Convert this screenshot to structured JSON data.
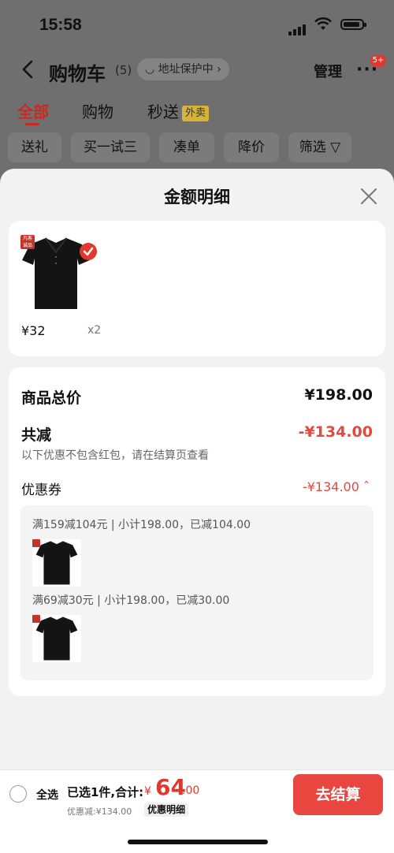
{
  "status": {
    "time": "15:58"
  },
  "nav": {
    "title": "购物车",
    "count": "(5)",
    "address": "地址保护中",
    "manage": "管理",
    "more": "···",
    "badge": "5+"
  },
  "tabs": {
    "all": "全部",
    "shop": "购物",
    "flash": "秒送",
    "waimai": "外卖"
  },
  "chips": [
    "送礼",
    "买一试三",
    "凑单",
    "降价",
    "筛选"
  ],
  "sheet": {
    "title": "金额明细",
    "brand_tag": "凡客\n诚品",
    "product": {
      "price": "¥32",
      "qty": "x2"
    },
    "rows": {
      "total_label": "商品总价",
      "total_value": "¥198.00",
      "reduce_label": "共减",
      "reduce_value": "-¥134.00",
      "note": "以下优惠不包含红包，请在结算页查看",
      "coupon_label": "优惠券",
      "coupon_value": "-¥134.00"
    },
    "coupons": [
      {
        "text": "满159减104元 | 小计198.00，已减104.00"
      },
      {
        "text": "满69减30元 | 小计198.00，已减30.00"
      }
    ]
  },
  "bottom": {
    "select_all": "全选",
    "selected_info": "已选1件,合计:",
    "currency": "¥",
    "total_int": "64",
    "total_dec": ".00",
    "discount": "优惠减:¥134.00",
    "detail": "优惠明细",
    "checkout": "去结算"
  },
  "colors": {
    "accent": "#e2372c",
    "button": "#e8463f"
  }
}
